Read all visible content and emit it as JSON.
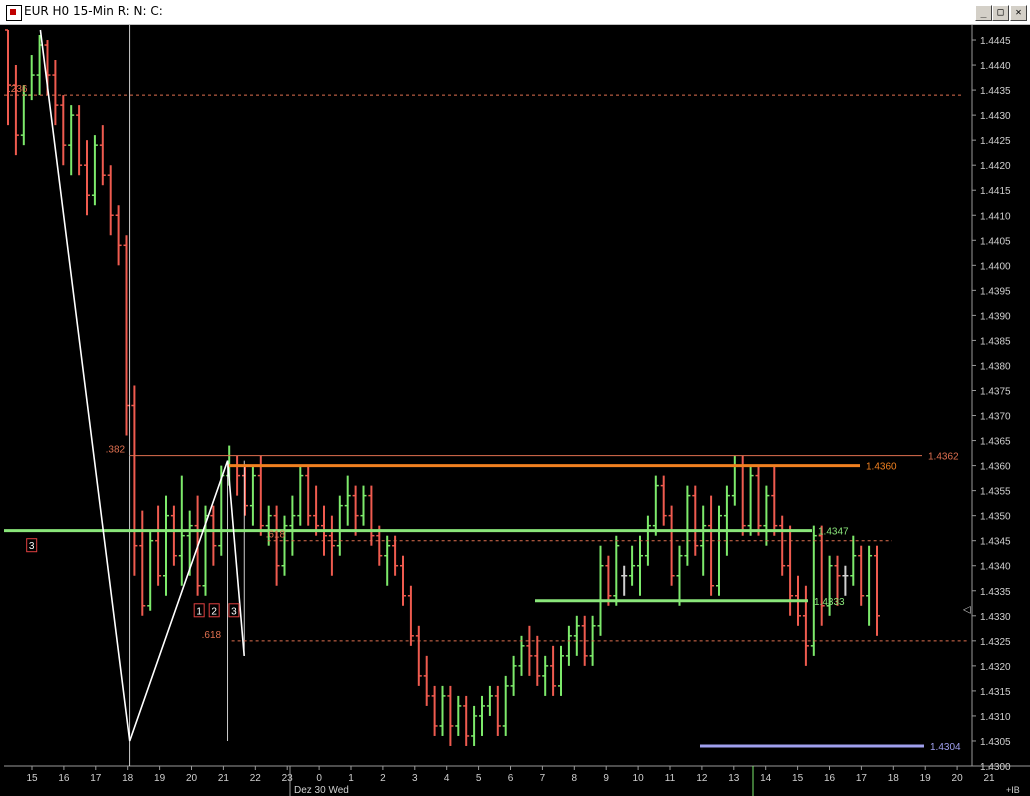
{
  "window": {
    "title": "EUR H0 15-Min R: N: C:",
    "buttons": {
      "minimize": "_",
      "restore": "□",
      "close": "✕"
    }
  },
  "colors": {
    "background": "#000000",
    "up_bar": "#7dea6b",
    "down_bar": "#ef5b4f",
    "neutral_bar": "#d0d0d0",
    "zigzag": "#ffffff",
    "fib_line": "#e07050",
    "resistance_orange": "#f08020",
    "support_green": "#8ae67a",
    "target_violet": "#a0a0ee"
  },
  "chart_data": {
    "type": "ohlc",
    "symbol": "EUR H0",
    "timeframe": "15-Min",
    "ylim": [
      1.43,
      1.4448
    ],
    "y_ticks": [
      1.4445,
      1.444,
      1.4435,
      1.443,
      1.4425,
      1.442,
      1.4415,
      1.441,
      1.4405,
      1.44,
      1.4395,
      1.439,
      1.4385,
      1.438,
      1.4375,
      1.437,
      1.4365,
      1.436,
      1.4355,
      1.435,
      1.4345,
      1.434,
      1.4335,
      1.433,
      1.4325,
      1.432,
      1.4315,
      1.431,
      1.4305,
      1.43
    ],
    "x_ticks": [
      "15",
      "16",
      "17",
      "18",
      "19",
      "20",
      "21",
      "22",
      "23",
      "0",
      "1",
      "2",
      "3",
      "4",
      "5",
      "6",
      "7",
      "8",
      "9",
      "10",
      "11",
      "12",
      "13",
      "14",
      "15",
      "16",
      "17",
      "18",
      "19",
      "20",
      "21"
    ],
    "date_label": "Dez 30 Wed",
    "corner_label": "+IB",
    "bars": [
      [
        1.4447,
        1.4447,
        1.4428,
        1.4436
      ],
      [
        1.4436,
        1.444,
        1.4422,
        1.4426
      ],
      [
        1.4426,
        1.4436,
        1.4424,
        1.4434
      ],
      [
        1.4434,
        1.4442,
        1.4433,
        1.4438
      ],
      [
        1.4438,
        1.4446,
        1.4434,
        1.4444
      ],
      [
        1.4444,
        1.4445,
        1.4434,
        1.4438
      ],
      [
        1.4438,
        1.4441,
        1.4428,
        1.4432
      ],
      [
        1.4432,
        1.4434,
        1.442,
        1.4424
      ],
      [
        1.4424,
        1.4432,
        1.4418,
        1.443
      ],
      [
        1.443,
        1.4432,
        1.4418,
        1.442
      ],
      [
        1.442,
        1.4425,
        1.441,
        1.4414
      ],
      [
        1.4414,
        1.4426,
        1.4412,
        1.4424
      ],
      [
        1.4424,
        1.4428,
        1.4416,
        1.4418
      ],
      [
        1.4418,
        1.442,
        1.4406,
        1.441
      ],
      [
        1.441,
        1.4412,
        1.44,
        1.4404
      ],
      [
        1.4404,
        1.4406,
        1.4366,
        1.4372
      ],
      [
        1.4372,
        1.4376,
        1.4338,
        1.4344
      ],
      [
        1.4344,
        1.4351,
        1.433,
        1.4332
      ],
      [
        1.4332,
        1.4347,
        1.4331,
        1.4345
      ],
      [
        1.4345,
        1.4352,
        1.4336,
        1.4338
      ],
      [
        1.4338,
        1.4354,
        1.4334,
        1.435
      ],
      [
        1.435,
        1.4352,
        1.434,
        1.4342
      ],
      [
        1.4342,
        1.4358,
        1.4336,
        1.4346
      ],
      [
        1.4346,
        1.4351,
        1.4338,
        1.4348
      ],
      [
        1.4348,
        1.4354,
        1.4334,
        1.4336
      ],
      [
        1.4336,
        1.4352,
        1.4334,
        1.435
      ],
      [
        1.435,
        1.4352,
        1.434,
        1.4344
      ],
      [
        1.4344,
        1.436,
        1.4342,
        1.4358
      ],
      [
        1.4358,
        1.4364,
        1.4356,
        1.436
      ],
      [
        1.436,
        1.4362,
        1.4354,
        1.4358
      ],
      [
        1.4358,
        1.436,
        1.435,
        1.4352
      ],
      [
        1.4352,
        1.436,
        1.4348,
        1.4358
      ],
      [
        1.4358,
        1.4362,
        1.4346,
        1.4348
      ],
      [
        1.4348,
        1.4352,
        1.4344,
        1.435
      ],
      [
        1.435,
        1.4352,
        1.4336,
        1.434
      ],
      [
        1.434,
        1.435,
        1.4338,
        1.4348
      ],
      [
        1.4348,
        1.4354,
        1.4342,
        1.435
      ],
      [
        1.435,
        1.436,
        1.4348,
        1.4358
      ],
      [
        1.4358,
        1.436,
        1.4348,
        1.435
      ],
      [
        1.435,
        1.4356,
        1.4346,
        1.4348
      ],
      [
        1.4348,
        1.4352,
        1.4342,
        1.4346
      ],
      [
        1.4346,
        1.435,
        1.4338,
        1.4344
      ],
      [
        1.4344,
        1.4354,
        1.4342,
        1.4352
      ],
      [
        1.4352,
        1.4358,
        1.4348,
        1.4354
      ],
      [
        1.4354,
        1.4356,
        1.4346,
        1.435
      ],
      [
        1.435,
        1.4356,
        1.4348,
        1.4354
      ],
      [
        1.4354,
        1.4356,
        1.4344,
        1.4346
      ],
      [
        1.4346,
        1.4348,
        1.434,
        1.4342
      ],
      [
        1.4342,
        1.4346,
        1.4336,
        1.4344
      ],
      [
        1.4344,
        1.4346,
        1.4338,
        1.434
      ],
      [
        1.434,
        1.4342,
        1.4332,
        1.4334
      ],
      [
        1.4334,
        1.4336,
        1.4324,
        1.4326
      ],
      [
        1.4326,
        1.4328,
        1.4316,
        1.4318
      ],
      [
        1.4318,
        1.4322,
        1.4312,
        1.4314
      ],
      [
        1.4314,
        1.4316,
        1.4306,
        1.4308
      ],
      [
        1.4308,
        1.4316,
        1.4306,
        1.4314
      ],
      [
        1.4314,
        1.4316,
        1.4304,
        1.4308
      ],
      [
        1.4308,
        1.4314,
        1.4306,
        1.4312
      ],
      [
        1.4312,
        1.4314,
        1.4304,
        1.4306
      ],
      [
        1.4306,
        1.4312,
        1.4304,
        1.431
      ],
      [
        1.431,
        1.4314,
        1.4306,
        1.4312
      ],
      [
        1.4312,
        1.4316,
        1.431,
        1.4314
      ],
      [
        1.4314,
        1.4316,
        1.4306,
        1.4308
      ],
      [
        1.4308,
        1.4318,
        1.4306,
        1.4316
      ],
      [
        1.4316,
        1.4322,
        1.4314,
        1.432
      ],
      [
        1.432,
        1.4326,
        1.4318,
        1.4324
      ],
      [
        1.4324,
        1.4328,
        1.4318,
        1.4322
      ],
      [
        1.4322,
        1.4326,
        1.4316,
        1.4318
      ],
      [
        1.4318,
        1.4322,
        1.4314,
        1.432
      ],
      [
        1.432,
        1.4324,
        1.4314,
        1.4316
      ],
      [
        1.4316,
        1.4324,
        1.4314,
        1.4322
      ],
      [
        1.4322,
        1.4328,
        1.432,
        1.4326
      ],
      [
        1.4326,
        1.433,
        1.4322,
        1.4328
      ],
      [
        1.4328,
        1.433,
        1.432,
        1.4322
      ],
      [
        1.4322,
        1.433,
        1.432,
        1.4328
      ],
      [
        1.4328,
        1.4344,
        1.4326,
        1.434
      ],
      [
        1.434,
        1.4342,
        1.4332,
        1.4334
      ],
      [
        1.4334,
        1.4346,
        1.4332,
        1.4344
      ],
      [
        1.4338,
        1.434,
        1.4334,
        1.4338
      ],
      [
        1.4338,
        1.4344,
        1.4336,
        1.434
      ],
      [
        1.434,
        1.4346,
        1.4334,
        1.4342
      ],
      [
        1.4342,
        1.435,
        1.434,
        1.4348
      ],
      [
        1.4348,
        1.4358,
        1.4346,
        1.4356
      ],
      [
        1.4356,
        1.4358,
        1.4348,
        1.435
      ],
      [
        1.435,
        1.4352,
        1.4336,
        1.4338
      ],
      [
        1.4338,
        1.4344,
        1.4332,
        1.4342
      ],
      [
        1.4342,
        1.4356,
        1.434,
        1.4354
      ],
      [
        1.4354,
        1.4356,
        1.4342,
        1.4344
      ],
      [
        1.4344,
        1.4352,
        1.4338,
        1.4348
      ],
      [
        1.4348,
        1.4354,
        1.4334,
        1.4336
      ],
      [
        1.4336,
        1.4352,
        1.4334,
        1.435
      ],
      [
        1.435,
        1.4356,
        1.4342,
        1.4354
      ],
      [
        1.4354,
        1.4362,
        1.4352,
        1.436
      ],
      [
        1.436,
        1.4362,
        1.4346,
        1.4348
      ],
      [
        1.4348,
        1.436,
        1.4346,
        1.4358
      ],
      [
        1.4358,
        1.436,
        1.4346,
        1.4348
      ],
      [
        1.4348,
        1.4356,
        1.4344,
        1.4354
      ],
      [
        1.4354,
        1.436,
        1.4346,
        1.4348
      ],
      [
        1.4348,
        1.435,
        1.4338,
        1.434
      ],
      [
        1.434,
        1.4348,
        1.433,
        1.4334
      ],
      [
        1.4334,
        1.4338,
        1.4328,
        1.433
      ],
      [
        1.433,
        1.4336,
        1.432,
        1.4324
      ],
      [
        1.4324,
        1.4348,
        1.4322,
        1.4346
      ],
      [
        1.4346,
        1.4348,
        1.4328,
        1.4332
      ],
      [
        1.4332,
        1.4342,
        1.433,
        1.434
      ],
      [
        1.434,
        1.4342,
        1.4332,
        1.4338
      ],
      [
        1.4338,
        1.434,
        1.4334,
        1.4338
      ],
      [
        1.4338,
        1.4346,
        1.4336,
        1.4342
      ],
      [
        1.4342,
        1.4344,
        1.4332,
        1.4334
      ],
      [
        1.4334,
        1.4344,
        1.4328,
        1.4342
      ],
      [
        1.4342,
        1.4344,
        1.4326,
        1.433
      ]
    ],
    "zigzag": [
      [
        1.4447,
        1.4447
      ],
      [
        15.4,
        1.4305
      ],
      [
        27.8,
        1.4361
      ],
      [
        29.9,
        1.4322
      ]
    ],
    "levels": [
      {
        "label": ".236",
        "price": 1.4434,
        "style": "dashed",
        "color_key": "fib_line"
      },
      {
        "label": ".382",
        "price_label": "1.4362",
        "price": 1.4362,
        "style": "solid",
        "color_key": "fib_line"
      },
      {
        "price_label": "1.4360",
        "price": 1.436,
        "style": "solid",
        "color_key": "resistance_orange"
      },
      {
        "price_label": "1.4347",
        "price": 1.4347,
        "style": "solid",
        "color_key": "support_green"
      },
      {
        "label": ".618",
        "price": 1.4345,
        "style": "dashed",
        "color_key": "fib_line"
      },
      {
        "price_label": "1.4333",
        "price": 1.4333,
        "style": "solid",
        "color_key": "support_green"
      },
      {
        "label": ".618",
        "price": 1.4325,
        "style": "dashed",
        "color_key": "fib_line"
      },
      {
        "price_label": "1.4304",
        "price": 1.4304,
        "style": "solid",
        "color_key": "target_violet"
      }
    ],
    "markers": [
      {
        "label": "3",
        "bar": 3.0,
        "price": 1.4344
      },
      {
        "label": "1",
        "bar": 24.2,
        "price": 1.4331
      },
      {
        "label": "2",
        "bar": 26.1,
        "price": 1.4331
      },
      {
        "label": "3",
        "bar": 28.6,
        "price": 1.4331
      }
    ],
    "axis_marker": "◁"
  }
}
